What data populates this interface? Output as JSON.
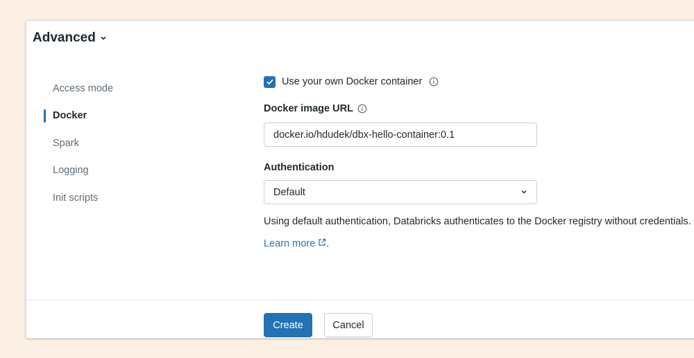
{
  "header": {
    "title": "Advanced",
    "chevron_icon": "chevron-down-icon"
  },
  "nav": {
    "items": [
      {
        "label": "Access mode",
        "active": false
      },
      {
        "label": "Docker",
        "active": true
      },
      {
        "label": "Spark",
        "active": false
      },
      {
        "label": "Logging",
        "active": false
      },
      {
        "label": "Init scripts",
        "active": false
      }
    ]
  },
  "docker": {
    "use_own_container": {
      "label": "Use your own Docker container",
      "checked": true
    },
    "image_url": {
      "label": "Docker image URL",
      "value": "docker.io/hdudek/dbx-hello-container:0.1"
    },
    "authentication": {
      "label": "Authentication",
      "selected": "Default",
      "help_text": "Using default authentication, Databricks authenticates to the Docker registry without credentials.",
      "learn_more": "Learn more",
      "learn_more_suffix": "."
    }
  },
  "footer": {
    "create_label": "Create",
    "cancel_label": "Cancel"
  },
  "colors": {
    "accent": "#2272b4",
    "background": "#fcefe3",
    "text": "#1f272d",
    "muted_text": "#5f6b75"
  }
}
